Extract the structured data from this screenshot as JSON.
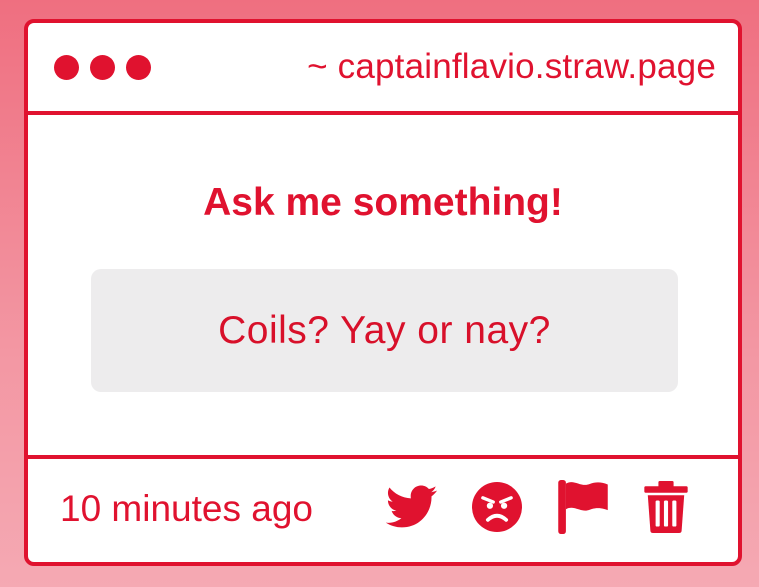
{
  "window": {
    "url": "~ captainflavio.straw.page"
  },
  "main": {
    "heading": "Ask me something!",
    "question": "Coils? Yay or nay?"
  },
  "footer": {
    "timestamp": "10 minutes ago",
    "actions": [
      {
        "icon": "twitter-icon"
      },
      {
        "icon": "angry-face-icon"
      },
      {
        "icon": "flag-icon"
      },
      {
        "icon": "trash-icon"
      }
    ]
  },
  "colors": {
    "accent": "#e0122f",
    "question_bg": "#edeced",
    "background": "#ef6f80"
  }
}
